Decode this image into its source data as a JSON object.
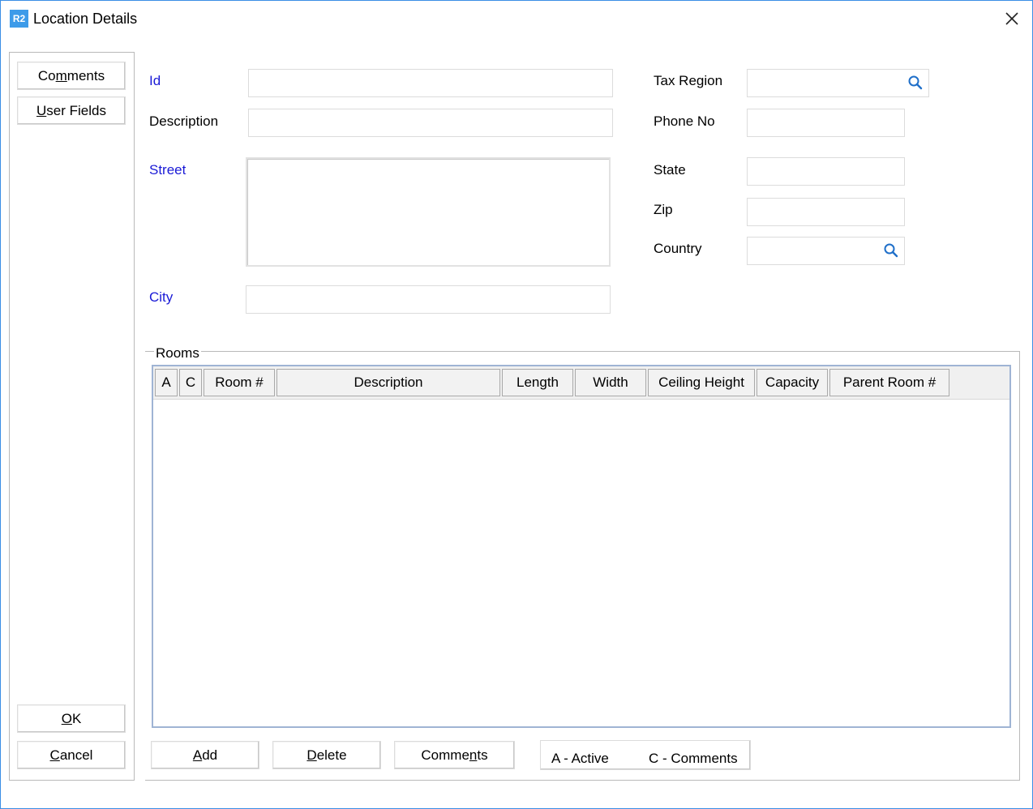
{
  "window": {
    "app_icon": "R2",
    "title": "Location Details",
    "close_icon": "close-x-icon"
  },
  "side": {
    "comments_pre": "Co",
    "comments_ul": "m",
    "comments_post": "ments",
    "userfields_ul": "U",
    "userfields_post": "ser Fields",
    "ok_ul": "O",
    "ok_post": "K",
    "cancel_ul": "C",
    "cancel_post": "ancel"
  },
  "form": {
    "id_label": "Id",
    "id_value": "",
    "description_label": "Description",
    "description_value": "",
    "street_label": "Street",
    "street_value": "",
    "city_label": "City",
    "city_value": "",
    "tax_region_label": "Tax Region",
    "tax_region_value": "",
    "phone_label": "Phone No",
    "phone_value": "",
    "state_label": "State",
    "state_value": "",
    "zip_label": "Zip",
    "zip_value": "",
    "country_label": "Country",
    "country_value": "",
    "lookup_icon": "search-icon",
    "required_color": "#1a1ad6"
  },
  "rooms": {
    "legend": "Rooms",
    "columns": [
      "A",
      "C",
      "Room #",
      "Description",
      "Length",
      "Width",
      "Ceiling Height",
      "Capacity",
      "Parent Room #"
    ],
    "rows": [],
    "add_ul": "A",
    "add_post": "dd",
    "delete_ul": "D",
    "delete_post": "elete",
    "comments_pre": "Comme",
    "comments_ul": "n",
    "comments_post": "ts",
    "legend_active": "A - Active",
    "legend_comments": "C - Comments"
  }
}
